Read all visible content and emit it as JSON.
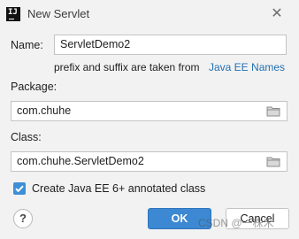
{
  "window": {
    "title": "New Servlet",
    "app_icon_text": "IJ"
  },
  "name": {
    "label": "Name:",
    "value": "ServletDemo2"
  },
  "hint": {
    "text": "prefix and suffix are taken from",
    "link": "Java EE Names"
  },
  "package": {
    "label": "Package:",
    "value": "com.chuhe"
  },
  "class": {
    "label": "Class:",
    "value": "com.chuhe.ServletDemo2"
  },
  "checkbox": {
    "label": "Create Java EE 6+ annotated class",
    "checked": true
  },
  "buttons": {
    "help": "?",
    "ok": "OK",
    "cancel": "Cancel"
  },
  "watermark": "CSDN @一株禾",
  "colors": {
    "accent": "#3c88d2",
    "link": "#2470b3",
    "checkbox": "#3d8fd6"
  },
  "icons": {
    "close": "close-icon",
    "browse": "folder-icon"
  }
}
